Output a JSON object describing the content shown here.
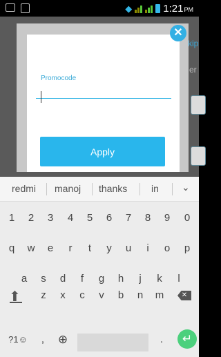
{
  "status_bar": {
    "time": "1:21",
    "ampm": "PM"
  },
  "background": {
    "skip_fragment": "kip",
    "fragment_2": "er"
  },
  "dialog": {
    "promo_label": "Promocode",
    "promo_value": "",
    "apply_label": "Apply",
    "close_glyph": "✕"
  },
  "keyboard": {
    "suggestions": [
      "redmi",
      "manoj",
      "thanks",
      "in"
    ],
    "collapse_glyph": "⌄",
    "row_numbers": [
      "1",
      "2",
      "3",
      "4",
      "5",
      "6",
      "7",
      "8",
      "9",
      "0"
    ],
    "row1": [
      "q",
      "w",
      "e",
      "r",
      "t",
      "y",
      "u",
      "i",
      "o",
      "p"
    ],
    "row2": [
      "a",
      "s",
      "d",
      "f",
      "g",
      "h",
      "j",
      "k",
      "l"
    ],
    "row3": [
      "z",
      "x",
      "c",
      "v",
      "b",
      "n",
      "m"
    ],
    "symbols_label": "?1☺",
    "comma": ",",
    "globe": "⊕",
    "period": ".",
    "enter_glyph": "↵"
  }
}
